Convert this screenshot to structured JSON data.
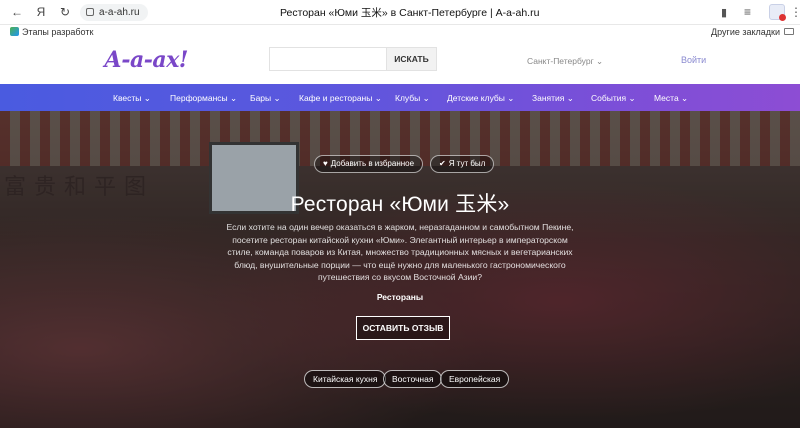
{
  "browser": {
    "url": "a-a-ah.ru",
    "title": "Ресторан «Юми 玉米» в Санкт-Петербурге | A-a-ah.ru",
    "bookmark_left": "Этапы разработк",
    "bookmark_right": "Другие закладки"
  },
  "header": {
    "logo": "А-а-ах!",
    "search_placeholder": "",
    "search_button": "ИСКАТЬ",
    "city": "Санкт-Петербург ⌄",
    "login": "Войти"
  },
  "nav": {
    "items": [
      {
        "label": "Квесты ⌄"
      },
      {
        "label": "Перформансы ⌄"
      },
      {
        "label": "Бары ⌄"
      },
      {
        "label": "Кафе и рестораны ⌄"
      },
      {
        "label": "Клубы ⌄"
      },
      {
        "label": "Детские клубы ⌄"
      },
      {
        "label": "Занятия ⌄"
      },
      {
        "label": "События ⌄"
      },
      {
        "label": "Места ⌄"
      }
    ]
  },
  "hero": {
    "favorite_button": "Добавить в избранное",
    "visited_button": "Я тут был",
    "title": "Ресторан «Юми 玉米»",
    "description": "Если хотите на один вечер оказаться в жарком, неразгаданном и самобытном Пекине, посетите ресторан китайской кухни «Юми». Элегантный интерьер в императорском стиле, команда поваров из Китая, множество традиционных мясных и вегетарианских блюд, внушительные порции — что ещё нужно для маленького гастрономического путешествия со вкусом Восточной Азии?",
    "category": "Рестораны",
    "review_button": "ОСТАВИТЬ ОТЗЫВ",
    "tags": [
      {
        "label": "Китайская кухня"
      },
      {
        "label": "Восточная"
      },
      {
        "label": "Европейская"
      }
    ],
    "calligraphy": "富贵和平图"
  },
  "colors": {
    "nav_start": "#4a5be0",
    "nav_end": "#8d4dd4",
    "logo": "#7a47c8"
  }
}
